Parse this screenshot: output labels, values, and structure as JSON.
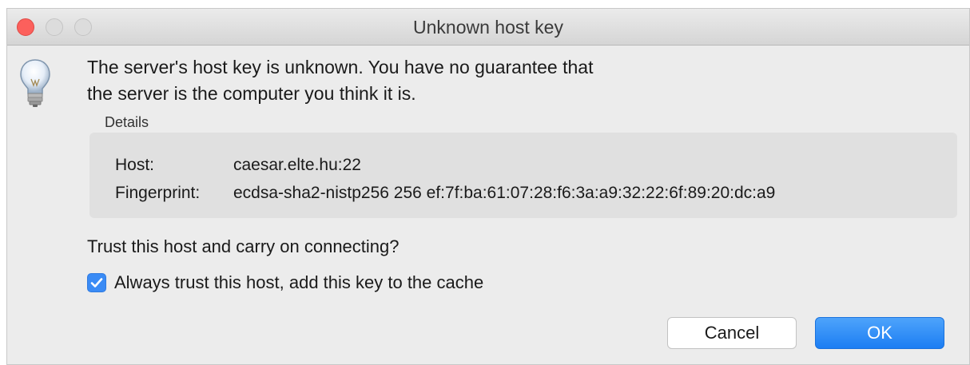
{
  "window": {
    "title": "Unknown host key"
  },
  "icon": "lightbulb-icon",
  "message": {
    "line1": "The server's host key is unknown. You have no guarantee that",
    "line2": "the server is the computer you think it is."
  },
  "details": {
    "label": "Details",
    "host_label": "Host:",
    "host_value": "caesar.elte.hu:22",
    "fingerprint_label": "Fingerprint:",
    "fingerprint_value": "ecdsa-sha2-nistp256 256 ef:7f:ba:61:07:28:f6:3a:a9:32:22:6f:89:20:dc:a9"
  },
  "question": "Trust this host and carry on connecting?",
  "checkbox": {
    "label": "Always trust this host, add this key to the cache",
    "checked": true
  },
  "buttons": {
    "cancel": "Cancel",
    "ok": "OK"
  },
  "colors": {
    "accent": "#1c7ef3",
    "close": "#fc605c"
  }
}
